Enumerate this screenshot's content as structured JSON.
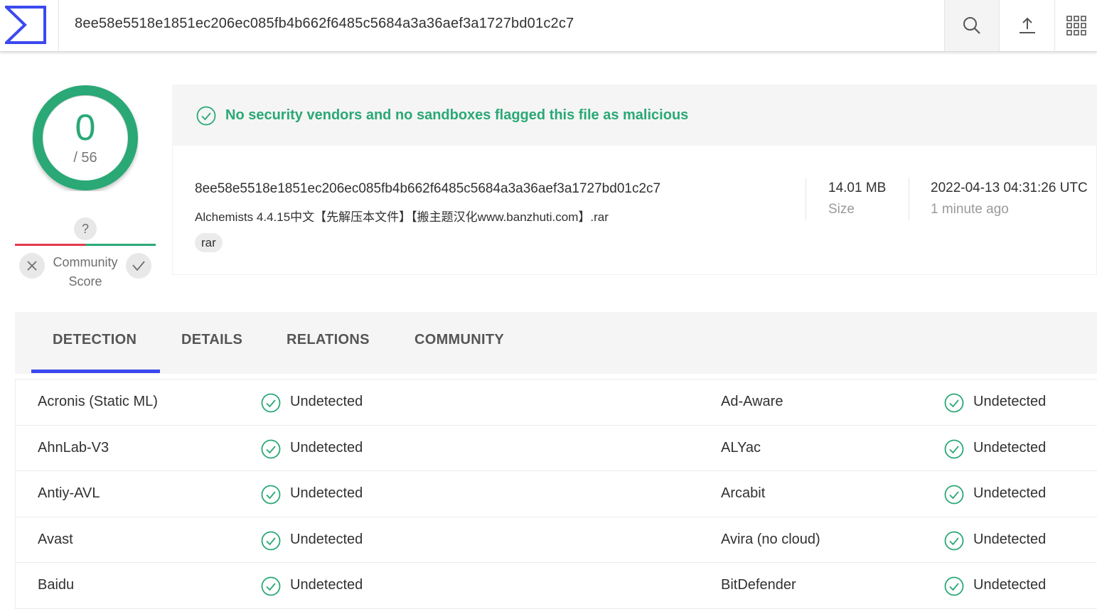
{
  "header": {
    "search_value": "8ee58e5518e1851ec206ec085fb4b662f6485c5684a3a36aef3a1727bd01c2c7",
    "icons": [
      "virustotal-logo-icon",
      "search-icon",
      "upload-icon",
      "apps-grid-icon"
    ]
  },
  "score": {
    "detections": "0",
    "total": "/ 56",
    "community_question": "?",
    "community_label_line1": "Community",
    "community_label_line2": "Score"
  },
  "verdict": {
    "message": "No security vendors and no sandboxes flagged this file as malicious"
  },
  "file": {
    "hash": "8ee58e5518e1851ec206ec085fb4b662f6485c5684a3a36aef3a1727bd01c2c7",
    "name": "Alchemists 4.4.15中文【先解压本文件】【搬主题汉化www.banzhuti.com】.rar",
    "tag": "rar",
    "size_value": "14.01 MB",
    "size_label": "Size",
    "date_value": "2022-04-13 04:31:26 UTC",
    "date_label": "1 minute ago"
  },
  "tabs": [
    "DETECTION",
    "DETAILS",
    "RELATIONS",
    "COMMUNITY"
  ],
  "active_tab": "DETECTION",
  "detections": [
    {
      "left_vendor": "Acronis (Static ML)",
      "left_result": "Undetected",
      "right_vendor": "Ad-Aware",
      "right_result": "Undetected"
    },
    {
      "left_vendor": "AhnLab-V3",
      "left_result": "Undetected",
      "right_vendor": "ALYac",
      "right_result": "Undetected"
    },
    {
      "left_vendor": "Antiy-AVL",
      "left_result": "Undetected",
      "right_vendor": "Arcabit",
      "right_result": "Undetected"
    },
    {
      "left_vendor": "Avast",
      "left_result": "Undetected",
      "right_vendor": "Avira (no cloud)",
      "right_result": "Undetected"
    },
    {
      "left_vendor": "Baidu",
      "left_result": "Undetected",
      "right_vendor": "BitDefender",
      "right_result": "Undetected"
    }
  ],
  "colors": {
    "clean_green": "#2aa876",
    "malicious_red": "#e23b4b",
    "accent_blue": "#3b49ef"
  }
}
